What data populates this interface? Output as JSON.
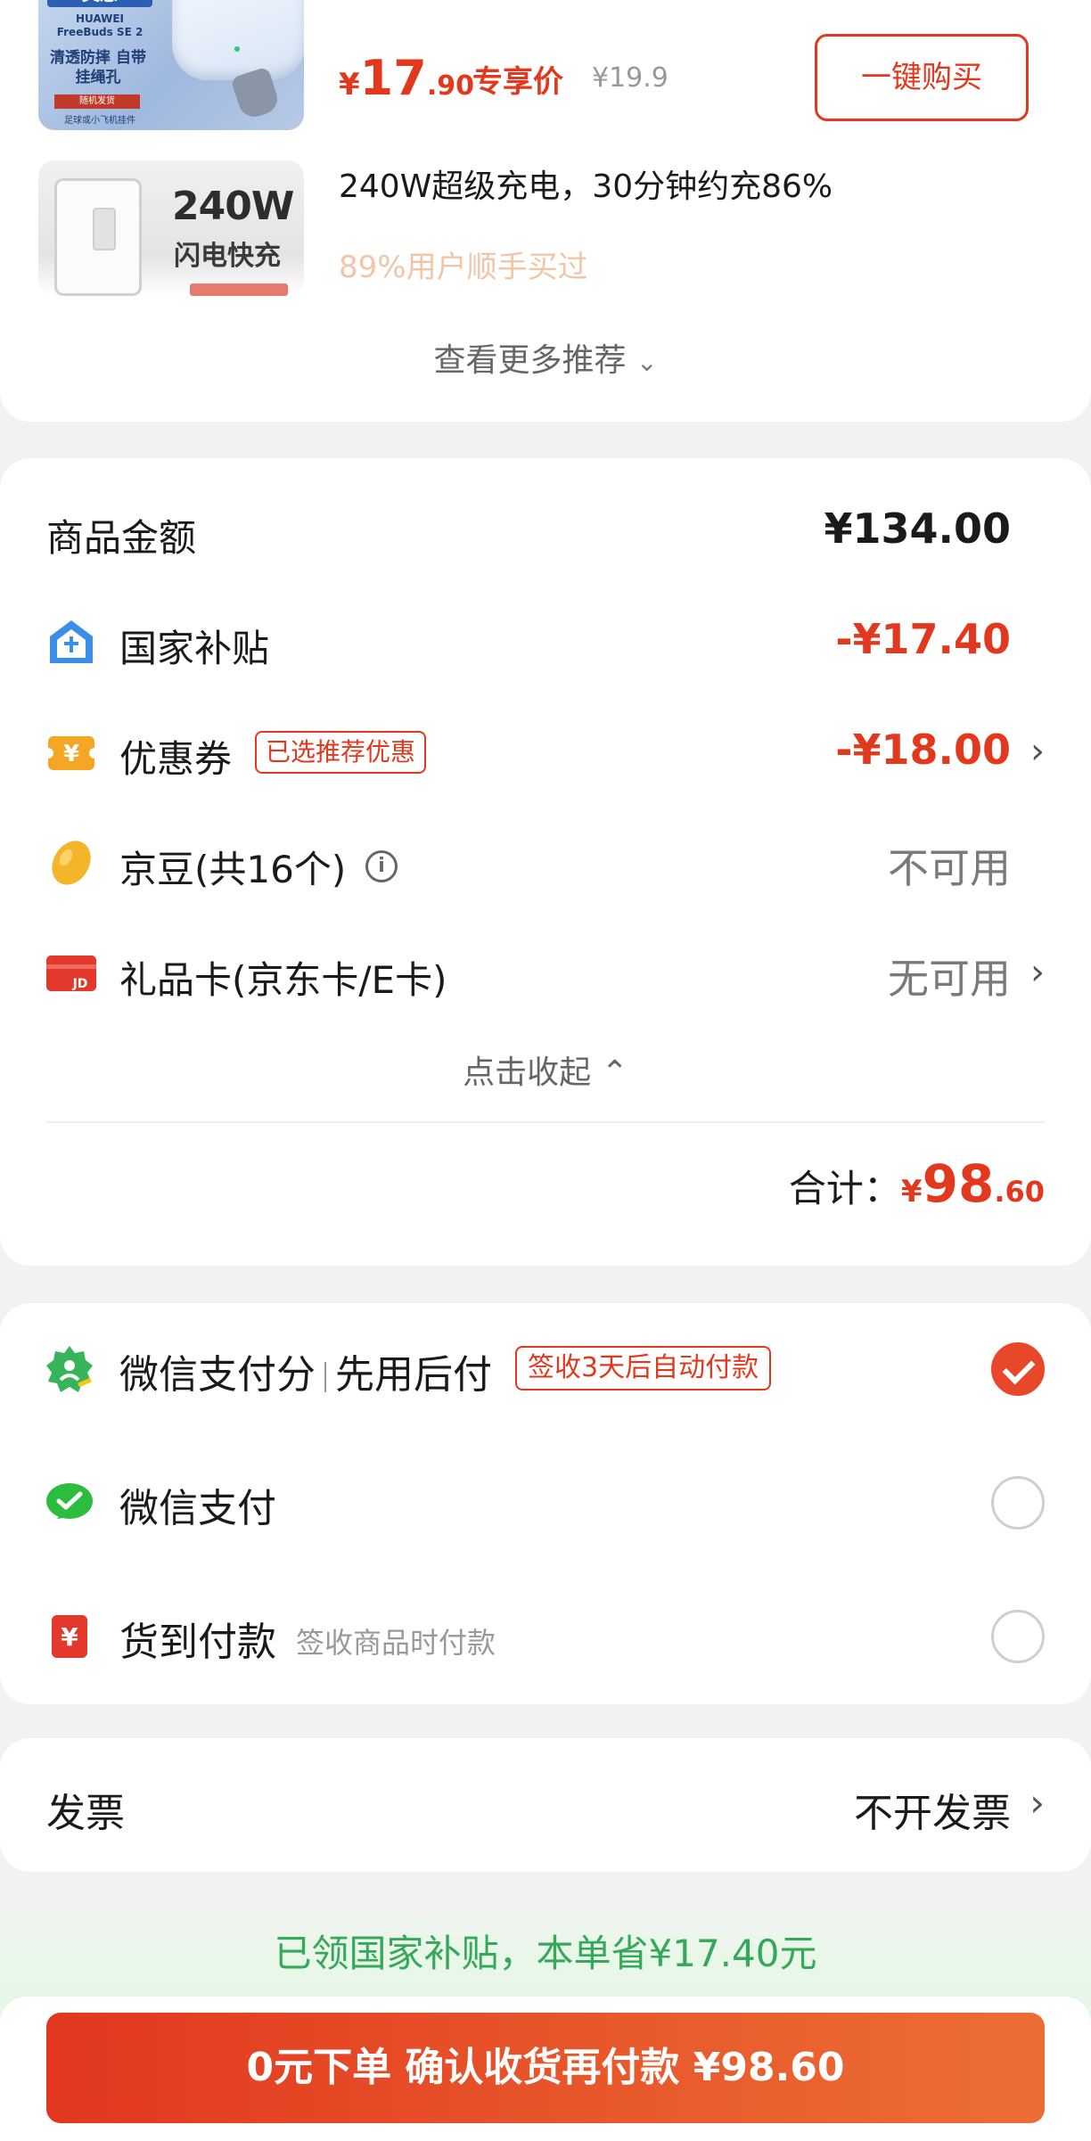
{
  "recommendations": [
    {
      "thumb": {
        "tag": "美感",
        "brand": "HUAWEI FreeBuds SE 2",
        "feature": "清透防摔 自带挂绳孔",
        "note": "随机发货",
        "sub": "足球或小飞机挂件"
      },
      "price_currency": "¥",
      "price_int": "17",
      "price_dec": ".90",
      "price_tag": "专享价",
      "old_price": "¥19.9",
      "buy_label": "一键购买"
    },
    {
      "thumb": {
        "big": "240W",
        "small": "闪电快充"
      },
      "title": "240W超级充电，30分钟约充86%",
      "social": "89%用户顺手买过"
    }
  ],
  "more_recs_label": "查看更多推荐",
  "price_breakdown": {
    "goods_amount_label": "商品金额",
    "goods_amount_value": "¥134.00",
    "subsidy_label": "国家补贴",
    "subsidy_value": "-¥17.40",
    "coupon_label": "优惠券",
    "coupon_badge": "已选推荐优惠",
    "coupon_value": "-¥18.00",
    "jingdou_label": "京豆(共16个)",
    "jingdou_value": "不可用",
    "giftcard_label": "礼品卡(京东卡/E卡)",
    "giftcard_value": "无可用",
    "collapse_label": "点击收起",
    "total_label": "合计：",
    "total_currency": "¥",
    "total_int": "98",
    "total_dec": ".60"
  },
  "payment": {
    "options": [
      {
        "label_a": "微信支付分",
        "label_b": "先用后付",
        "badge": "签收3天后自动付款",
        "selected": true
      },
      {
        "label_a": "微信支付",
        "selected": false
      },
      {
        "label_a": "货到付款",
        "hint": "签收商品时付款",
        "selected": false
      }
    ]
  },
  "invoice": {
    "label": "发票",
    "value": "不开发票"
  },
  "subsidy_banner": "已领国家补贴，本单省¥17.40元",
  "submit_label": "0元下单 确认收货再付款 ¥98.60",
  "colors": {
    "accent_red": "#e2391e",
    "subsidy_green": "#35a85a",
    "wechat_green": "#2cbd3f",
    "hint_peach": "#f0c6a6"
  },
  "icons": {
    "subsidy": "house-shield-icon",
    "coupon": "yen-coupon-icon",
    "jingdou": "bean-icon",
    "giftcard": "jd-card-icon",
    "wechat_score": "wechat-score-icon",
    "wechat_pay": "wechat-pay-icon",
    "cod": "yen-cash-icon"
  }
}
